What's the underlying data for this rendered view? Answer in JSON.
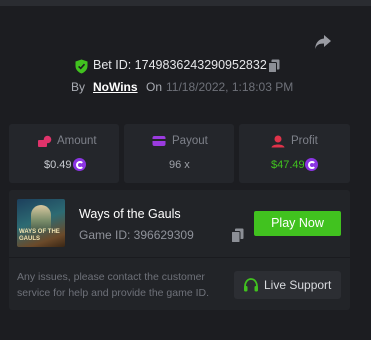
{
  "bet": {
    "id_text": "Bet ID: 1749836243290952832",
    "by_label": "By",
    "user": "NoWins",
    "on_label": "On",
    "date": "11/18/2022, 1:18:03 PM"
  },
  "stats": {
    "amount": {
      "label": "Amount",
      "value": "$0.49",
      "icon": "coins-icon",
      "icon_color": "#e0336b"
    },
    "payout": {
      "label": "Payout",
      "value": "96 x",
      "icon": "wallet-icon",
      "icon_color": "#9b3be0"
    },
    "profit": {
      "label": "Profit",
      "value": "$47.49",
      "icon": "profit-icon",
      "icon_color": "#e0334a",
      "value_color": "#41c21f"
    }
  },
  "game": {
    "title": "Ways of the Gauls",
    "id_text": "Game ID: 396629309",
    "thumb_text": "WAYS OF THE GAULS",
    "play_label": "Play Now",
    "help_text": "Any issues, please contact the customer service for help and provide the game ID.",
    "support_label": "Live Support"
  },
  "colors": {
    "accent_green": "#41c21f",
    "coin_purple": "#8b35e3",
    "shield_green": "#41c21f"
  }
}
